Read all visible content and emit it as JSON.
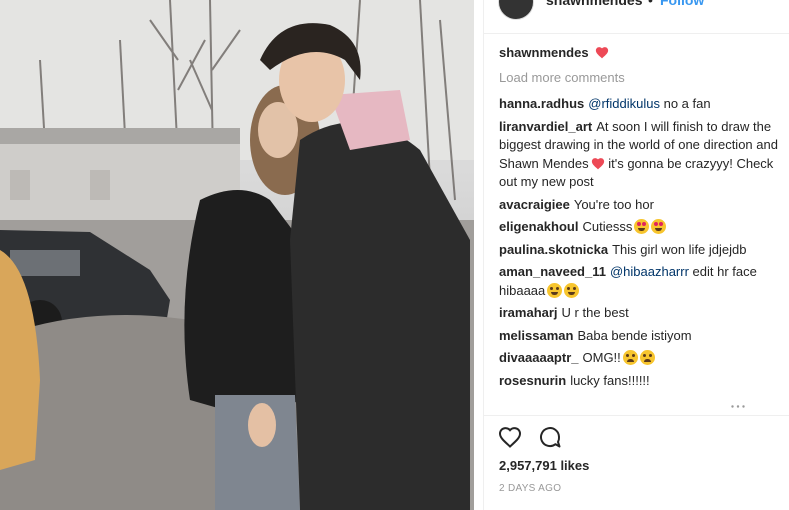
{
  "header": {
    "username": "shawnmendes",
    "dot": "•",
    "follow_label": "Follow"
  },
  "caption": {
    "username": "shawnmendes",
    "icon": "red-heart"
  },
  "load_more_label": "Load more comments",
  "comments": [
    {
      "user": "hanna.radhus",
      "mention": "@rfiddikulus",
      "text": " no a fan"
    },
    {
      "user": "liranvardiel_art",
      "text1": "At soon I will finish to draw the biggest drawing in the world of one direction and Shawn Mendes",
      "text2": " it's gonna be crazyyy! Check out my new post"
    },
    {
      "user": "avacraigiee",
      "text": "You're too hor"
    },
    {
      "user": "eligenakhoul",
      "text": "Cutiesss"
    },
    {
      "user": "paulina.skotnicka",
      "text": "This girl won life jdjejdb"
    },
    {
      "user": "aman_naveed_11",
      "mention": "@hibaazharrr",
      "text": " edit hr face hibaaaa"
    },
    {
      "user": "iramaharj",
      "text": "U r the best"
    },
    {
      "user": "melissaman",
      "text": "Baba bende istiyom"
    },
    {
      "user": "divaaaaaptr_",
      "text": "OMG!!"
    },
    {
      "user": "rosesnurin",
      "text": "lucky fans!!!!!!"
    }
  ],
  "likes": "2,957,791 likes",
  "date": "2 DAYS AGO",
  "colors": {
    "link": "#003569",
    "heart": "#ed4956",
    "follow": "#3897f0",
    "muted": "#999999"
  }
}
